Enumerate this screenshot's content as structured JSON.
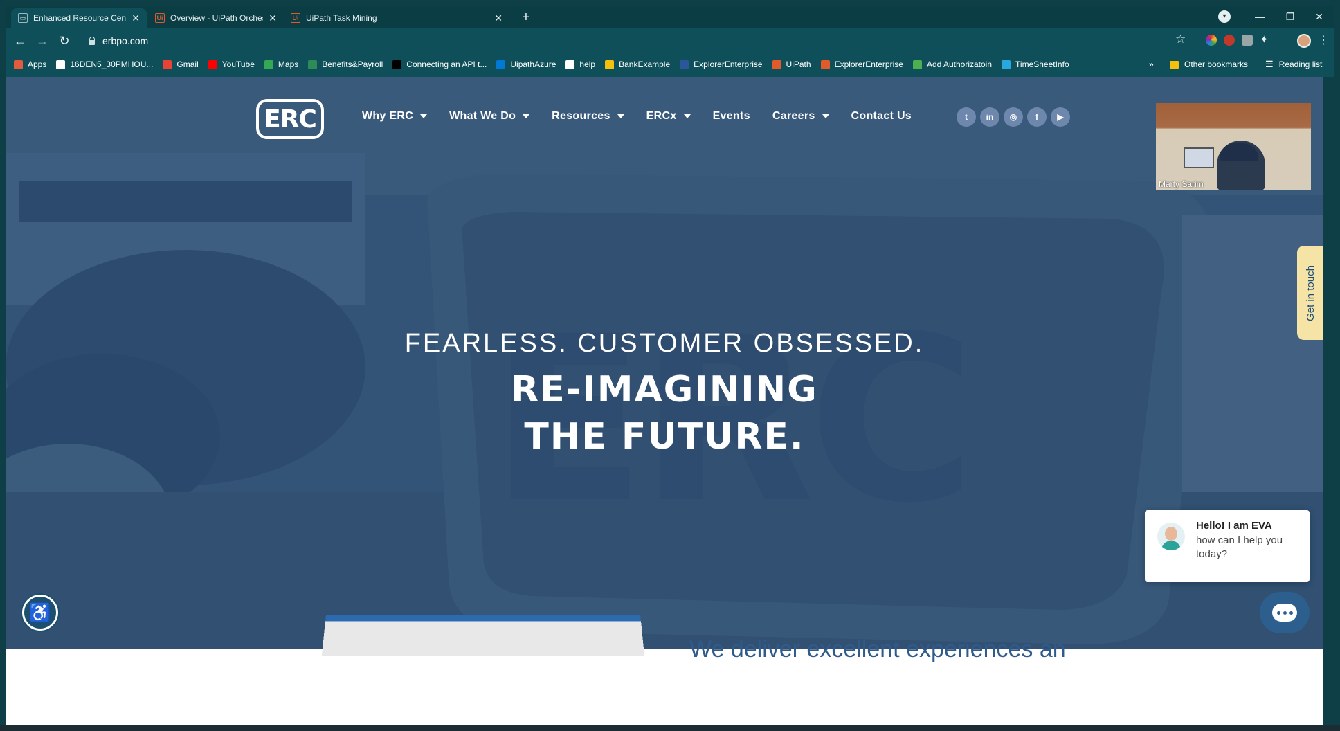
{
  "browser": {
    "tabs": [
      {
        "label": "Enhanced Resource Centers - ERC",
        "icon": "web-page-icon",
        "active": true
      },
      {
        "label": "Overview - UiPath Orchestrator",
        "icon": "uipath-icon",
        "active": false
      },
      {
        "label": "UiPath Task Mining",
        "icon": "uipath-icon",
        "active": false
      }
    ],
    "url": "erbpo.com",
    "bookmarks": [
      {
        "label": "Apps",
        "color": "#e25b3c"
      },
      {
        "label": "16DEN5_30PMHOU...",
        "color": "#ffffff"
      },
      {
        "label": "Gmail",
        "color": "#ea4335"
      },
      {
        "label": "YouTube",
        "color": "#ff0000"
      },
      {
        "label": "Maps",
        "color": "#34a853"
      },
      {
        "label": "Benefits&Payroll",
        "color": "#2e8b57"
      },
      {
        "label": "Connecting an API t...",
        "color": "#000000"
      },
      {
        "label": "UipathAzure",
        "color": "#0078d4"
      },
      {
        "label": "help",
        "color": "#ffffff"
      },
      {
        "label": "BankExample",
        "color": "#f4c20d"
      },
      {
        "label": "ExplorerEnterprise",
        "color": "#2b579a"
      },
      {
        "label": "UiPath",
        "color": "#e05a2a"
      },
      {
        "label": "ExplorerEnterprise",
        "color": "#e05a2a"
      },
      {
        "label": "Add Authorizatoin",
        "color": "#4caf50"
      },
      {
        "label": "TimeSheetInfo",
        "color": "#29a8e0"
      }
    ],
    "bookmarks_overflow": "»",
    "other_bookmarks": "Other bookmarks",
    "reading_list": "Reading list"
  },
  "site": {
    "logo_text": "ERC",
    "nav": [
      {
        "label": "Why ERC",
        "dropdown": true
      },
      {
        "label": "What We Do",
        "dropdown": true
      },
      {
        "label": "Resources",
        "dropdown": true
      },
      {
        "label": "ERCx",
        "dropdown": true
      },
      {
        "label": "Events",
        "dropdown": false
      },
      {
        "label": "Careers",
        "dropdown": true
      },
      {
        "label": "Contact Us",
        "dropdown": false
      }
    ],
    "social": [
      {
        "name": "twitter-icon",
        "glyph": "t"
      },
      {
        "name": "linkedin-icon",
        "glyph": "in"
      },
      {
        "name": "instagram-icon",
        "glyph": "◎"
      },
      {
        "name": "facebook-icon",
        "glyph": "f"
      },
      {
        "name": "youtube-icon",
        "glyph": "▶"
      }
    ],
    "hero": {
      "tagline": "FEARLESS. CUSTOMER OBSESSED.",
      "headline_line1": "RE-IMAGINING",
      "headline_line2": "THE FUTURE."
    },
    "get_in_touch": "Get in touch",
    "teaser": "We deliver excellent experiences an",
    "chat": {
      "title": "Hello! I am EVA",
      "message": "how can I help you today?"
    }
  },
  "video_call": {
    "participant": "Marty Sarim"
  }
}
